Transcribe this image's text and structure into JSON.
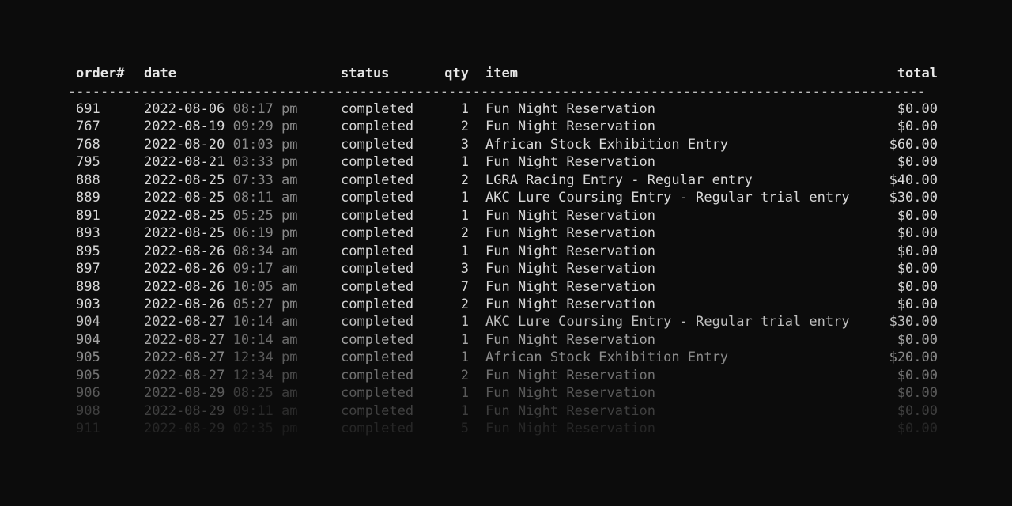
{
  "table": {
    "headers": {
      "order": "order#",
      "date": "date",
      "status": "status",
      "qty": "qty",
      "item": "item",
      "total": "total"
    },
    "divider": "----------------------------------------------------------------------------------------------------------",
    "rows": [
      {
        "order": "691",
        "date": "2022-08-06",
        "time": "08:17 pm",
        "status": "completed",
        "qty": "1",
        "item": "Fun Night Reservation",
        "total": "$0.00"
      },
      {
        "order": "767",
        "date": "2022-08-19",
        "time": "09:29 pm",
        "status": "completed",
        "qty": "2",
        "item": "Fun Night Reservation",
        "total": "$0.00"
      },
      {
        "order": "768",
        "date": "2022-08-20",
        "time": "01:03 pm",
        "status": "completed",
        "qty": "3",
        "item": "African Stock Exhibition Entry",
        "total": "$60.00"
      },
      {
        "order": "795",
        "date": "2022-08-21",
        "time": "03:33 pm",
        "status": "completed",
        "qty": "1",
        "item": "Fun Night Reservation",
        "total": "$0.00"
      },
      {
        "order": "888",
        "date": "2022-08-25",
        "time": "07:33 am",
        "status": "completed",
        "qty": "2",
        "item": "LGRA Racing Entry - Regular entry",
        "total": "$40.00"
      },
      {
        "order": "889",
        "date": "2022-08-25",
        "time": "08:11 am",
        "status": "completed",
        "qty": "1",
        "item": "AKC Lure Coursing Entry - Regular trial entry",
        "total": "$30.00"
      },
      {
        "order": "891",
        "date": "2022-08-25",
        "time": "05:25 pm",
        "status": "completed",
        "qty": "1",
        "item": "Fun Night Reservation",
        "total": "$0.00"
      },
      {
        "order": "893",
        "date": "2022-08-25",
        "time": "06:19 pm",
        "status": "completed",
        "qty": "2",
        "item": "Fun Night Reservation",
        "total": "$0.00"
      },
      {
        "order": "895",
        "date": "2022-08-26",
        "time": "08:34 am",
        "status": "completed",
        "qty": "1",
        "item": "Fun Night Reservation",
        "total": "$0.00"
      },
      {
        "order": "897",
        "date": "2022-08-26",
        "time": "09:17 am",
        "status": "completed",
        "qty": "3",
        "item": "Fun Night Reservation",
        "total": "$0.00"
      },
      {
        "order": "898",
        "date": "2022-08-26",
        "time": "10:05 am",
        "status": "completed",
        "qty": "7",
        "item": "Fun Night Reservation",
        "total": "$0.00"
      },
      {
        "order": "903",
        "date": "2022-08-26",
        "time": "05:27 pm",
        "status": "completed",
        "qty": "2",
        "item": "Fun Night Reservation",
        "total": "$0.00"
      },
      {
        "order": "904",
        "date": "2022-08-27",
        "time": "10:14 am",
        "status": "completed",
        "qty": "1",
        "item": "AKC Lure Coursing Entry - Regular trial entry",
        "total": "$30.00"
      },
      {
        "order": "904",
        "date": "2022-08-27",
        "time": "10:14 am",
        "status": "completed",
        "qty": "1",
        "item": "Fun Night Reservation",
        "total": "$0.00"
      },
      {
        "order": "905",
        "date": "2022-08-27",
        "time": "12:34 pm",
        "status": "completed",
        "qty": "1",
        "item": "African Stock Exhibition Entry",
        "total": "$20.00"
      },
      {
        "order": "905",
        "date": "2022-08-27",
        "time": "12:34 pm",
        "status": "completed",
        "qty": "2",
        "item": "Fun Night Reservation",
        "total": "$0.00"
      },
      {
        "order": "906",
        "date": "2022-08-29",
        "time": "08:25 am",
        "status": "completed",
        "qty": "1",
        "item": "Fun Night Reservation",
        "total": "$0.00"
      },
      {
        "order": "908",
        "date": "2022-08-29",
        "time": "09:11 am",
        "status": "completed",
        "qty": "1",
        "item": "Fun Night Reservation",
        "total": "$0.00"
      },
      {
        "order": "911",
        "date": "2022-08-29",
        "time": "02:35 pm",
        "status": "completed",
        "qty": "5",
        "item": "Fun Night Reservation",
        "total": "$0.00"
      }
    ]
  }
}
